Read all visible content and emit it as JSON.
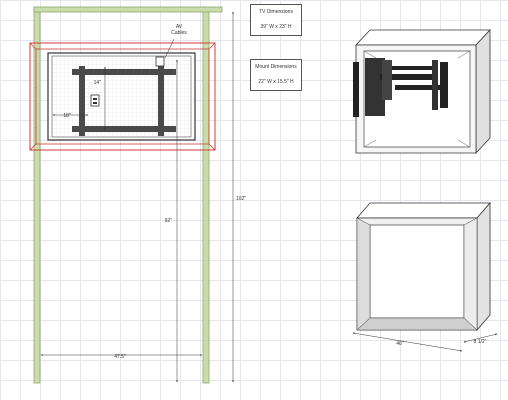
{
  "tv_box": {
    "title": "TV Dimensions",
    "value": "39\" W x 23\" H"
  },
  "mount_box": {
    "title": "Mount Dimensions",
    "value": "22\" W x 15.5\" H"
  },
  "callouts": {
    "av_cables_line1": "AV",
    "av_cables_line2": "Cables"
  },
  "dimensions": {
    "mount_width": "18\"",
    "mount_height": "14\"",
    "outlet_height": "92\"",
    "post_height": "102\"",
    "post_spacing": "47.5\"",
    "box_width": "46\"",
    "box_depth": "8 1/2\""
  },
  "colors": {
    "post": "#c9dcaa",
    "outline_red": "#d23a3a",
    "mount": "#4a4a4a"
  }
}
